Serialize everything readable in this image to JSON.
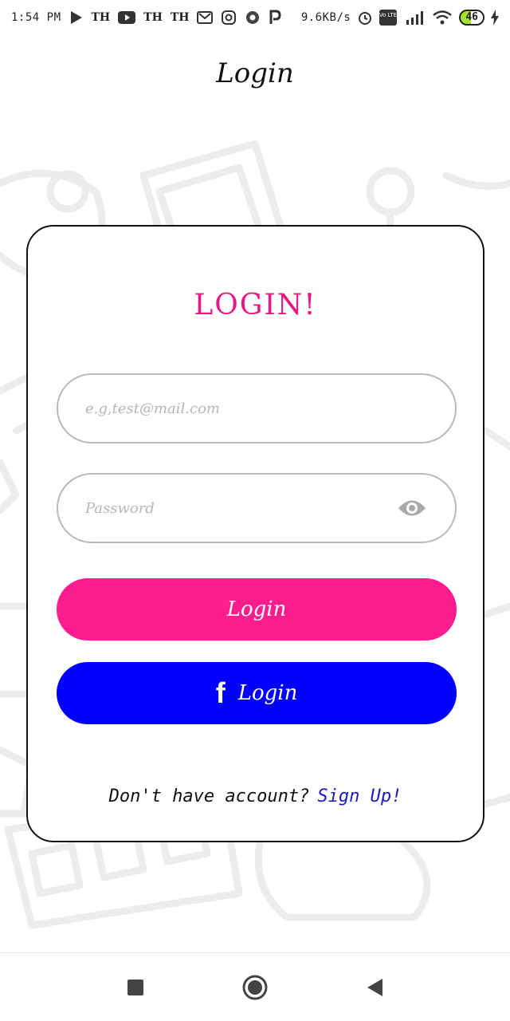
{
  "status_bar": {
    "time": "1:54 PM",
    "th1": "TH",
    "th2": "TH",
    "th3": "TH",
    "net_speed": "9.6KB/s",
    "volte": "Vo LTE",
    "battery": "46"
  },
  "page_title": "Login",
  "card": {
    "title": "LOGIN!",
    "email": {
      "value": "",
      "placeholder": "e.g,test@mail.com"
    },
    "password": {
      "value": "",
      "placeholder": "Password"
    },
    "login_button": "Login",
    "facebook_button": {
      "icon": "facebook-f-icon",
      "label": "Login"
    },
    "signup_prompt": "Don't have account?",
    "signup_link": "Sign Up!"
  },
  "colors": {
    "accent_pink": "#fe1d8f",
    "title_pink": "#e5197f",
    "facebook_blue": "#0000fe",
    "link_blue": "#1a1ac8"
  },
  "nav": {
    "recents_icon": "square-icon",
    "home_icon": "circle-home-icon",
    "back_icon": "triangle-back-icon"
  }
}
